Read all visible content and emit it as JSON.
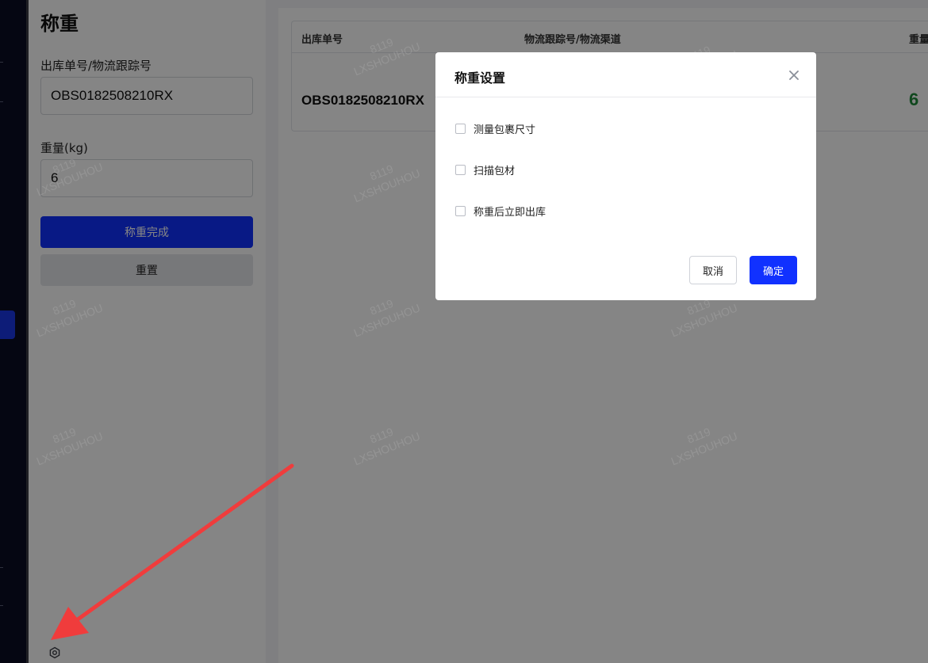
{
  "page_title": "称重",
  "form": {
    "order_label": "出库单号/物流跟踪号",
    "order_value": "OBS0182508210RX",
    "weight_label": "重量(kg)",
    "weight_value": "6",
    "complete_button": "称重完成",
    "reset_button": "重置",
    "settings_icon": "gear-icon"
  },
  "table": {
    "columns": [
      "出库单号",
      "物流跟踪号/物流渠道",
      "重量"
    ],
    "rows": [
      {
        "order_no": "OBS0182508210RX",
        "weight": "6"
      }
    ]
  },
  "modal": {
    "title": "称重设置",
    "close_icon": "close-icon",
    "options": [
      {
        "label": "测量包裹尺寸",
        "checked": false
      },
      {
        "label": "扫描包材",
        "checked": false
      },
      {
        "label": "称重后立即出库",
        "checked": false
      }
    ],
    "cancel_button": "取消",
    "confirm_button": "确定"
  },
  "watermark": {
    "line1": "8119",
    "line2": "LXSHOUHOU"
  },
  "colors": {
    "primary": "#1131ff",
    "nav_bg": "#0b0d24",
    "weight_value": "#1f8a3b",
    "annotation_arrow": "#f03c3c"
  }
}
